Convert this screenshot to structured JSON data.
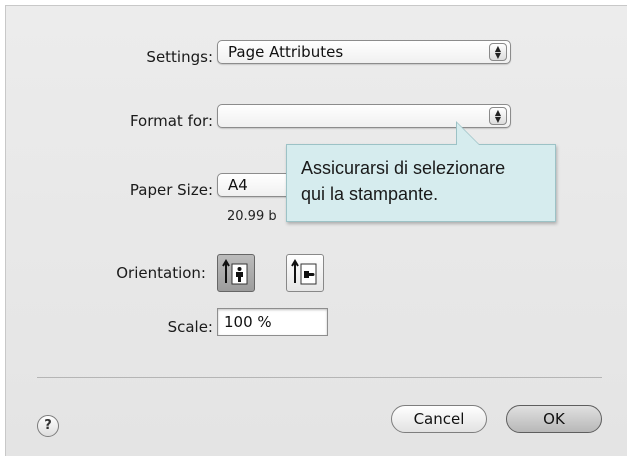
{
  "settings": {
    "label": "Settings:",
    "value": "Page Attributes"
  },
  "format_for": {
    "label": "Format for:",
    "value": ""
  },
  "paper_size": {
    "label": "Paper Size:",
    "value": "A4",
    "dimensions": "20.99 b"
  },
  "tooltip": {
    "line1": "Assicurarsi di selezionare",
    "line2": "qui la stampante."
  },
  "orientation": {
    "label": "Orientation:",
    "options": [
      "portrait-icon",
      "landscape-icon"
    ],
    "selected": "portrait"
  },
  "scale": {
    "label": "Scale:",
    "value": "100 %"
  },
  "buttons": {
    "help": "?",
    "cancel": "Cancel",
    "ok": "OK"
  }
}
